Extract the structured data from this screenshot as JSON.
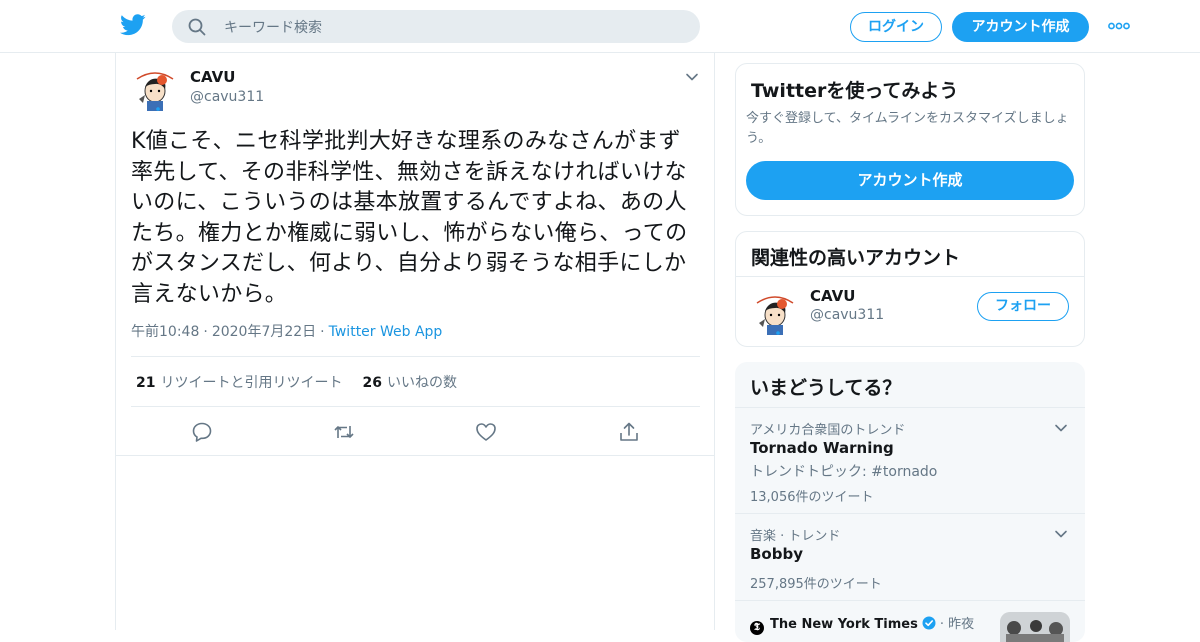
{
  "header": {
    "search_placeholder": "キーワード検索",
    "login_label": "ログイン",
    "signup_label": "アカウント作成"
  },
  "tweet": {
    "author_name": "CAVU",
    "author_handle": "@cavu311",
    "text": "K値こそ、ニセ科学批判大好きな理系のみなさんがまず率先して、その非科学性、無効さを訴えなければいけないのに、こういうのは基本放置するんですよね、あの人たち。権力とか権威に弱いし、怖がらない俺ら、ってのがスタンスだし、何より、自分より弱そうな相手にしか言えないから。",
    "time": "午前10:48",
    "date": "2020年7月22日",
    "app": "Twitter Web App",
    "retweets_count": "21",
    "retweets_label": "リツイートと引用リツイート",
    "likes_count": "26",
    "likes_label": "いいねの数"
  },
  "sidebar": {
    "signup_card": {
      "title": "Twitterを使ってみよう",
      "description": "今すぐ登録して、タイムラインをカスタマイズしましょう。",
      "button_label": "アカウント作成"
    },
    "related": {
      "title": "関連性の高いアカウント",
      "accounts": [
        {
          "name": "CAVU",
          "handle": "@cavu311",
          "follow_label": "フォロー"
        }
      ]
    },
    "trends": {
      "title": "いまどうしてる？",
      "items": [
        {
          "context": "アメリカ合衆国のトレンド",
          "name": "Tornado Warning",
          "subtitle": "トレンドトピック: #tornado",
          "count": "13,056件のツイート"
        },
        {
          "context": "音楽 · トレンド",
          "name": "Bobby",
          "count": "257,895件のツイート"
        }
      ],
      "news": {
        "source": "The New York Times",
        "time": "昨夜"
      }
    }
  },
  "colors": {
    "brand": "#1da1f2",
    "link": "#1b95e0",
    "secondary_text": "#657786",
    "border": "#e6ecf0"
  }
}
